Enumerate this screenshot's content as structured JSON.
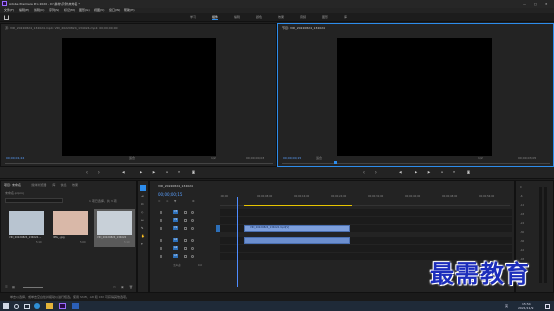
{
  "window": {
    "title": "Adobe Premiere Pro 2020 - D:\\素材\\示例\\未命名 *",
    "minimize": "—",
    "maximize": "□",
    "close": "✕"
  },
  "menu": [
    "文件(F)",
    "编辑(E)",
    "剪辑(C)",
    "序列(S)",
    "标记(M)",
    "图形(G)",
    "视图(V)",
    "窗口(W)",
    "帮助(H)"
  ],
  "workspaces": [
    "学习",
    "组件",
    "编辑",
    "颜色",
    "效果",
    "音频",
    "图形",
    "库"
  ],
  "active_workspace_index": 1,
  "source_monitor": {
    "tab": "源: VID_20220824_134024.mp4: VID_20220824_134024.mp4: 00;00;00;00",
    "timecode_left": "00;00;01;24",
    "fit_label": "适合",
    "fraction": "1/2",
    "timecode_right": "00;00;00;03"
  },
  "program_monitor": {
    "tab": "节目: VID_20220824_134024",
    "timecode_left": "00;00;00;15",
    "fit_label": "适合",
    "fraction": "1/2",
    "timecode_right": "00;00;03;05"
  },
  "project_panel": {
    "tabs": [
      "项目: 未命名",
      "媒体浏览器",
      "库",
      "信息",
      "效果"
    ],
    "project_name": "未命名.prproj",
    "search_placeholder": "",
    "item_count": "1 项已选择，共 3 项",
    "items": [
      {
        "name": "VID_20220824_134024....",
        "duration": "5:10"
      },
      {
        "name": "IMG_..jpg",
        "duration": "5:00"
      },
      {
        "name": "VID_20220824_134024",
        "duration": "5:10"
      }
    ]
  },
  "timeline": {
    "tab": "VID_20220824_134024",
    "timecode": "00;00;00;15",
    "ruler": [
      ":00;00",
      "00;00;08;00",
      "00;00;16;00",
      "00;00;24;00",
      "00;00;32;00",
      "00;00;40;00",
      "00;00;48;00",
      "00;00;56;00"
    ],
    "video_tracks": [
      "V3",
      "V2",
      "V1"
    ],
    "audio_tracks": [
      "A1",
      "A2",
      "A3"
    ],
    "mix_label": "主声道",
    "mix_value": "0.0",
    "clip_label": "VID_20220824_134024.mp4[V]",
    "playhead_fraction": 0.06
  },
  "audio_meter": {
    "scale": [
      "0",
      "-6",
      "-12",
      "-18",
      "-24",
      "-30",
      "-36",
      "-42",
      "-48",
      "-54",
      "dB"
    ]
  },
  "status_bar": "单击以选择，或单击空白处并拖动以进行框选。使用 Shift、Alt 和 Ctrl 可获得其他选项。",
  "watermark": "最需教育",
  "taskbar": {
    "time": "15:54",
    "date": "2021/11/9",
    "lang": "英"
  },
  "colors": {
    "accent": "#2d8ceb",
    "timecode": "#4e8cff",
    "clip": "#7d9fdc",
    "workarea": "#e6c400",
    "watermark": "#1c2dbb"
  }
}
